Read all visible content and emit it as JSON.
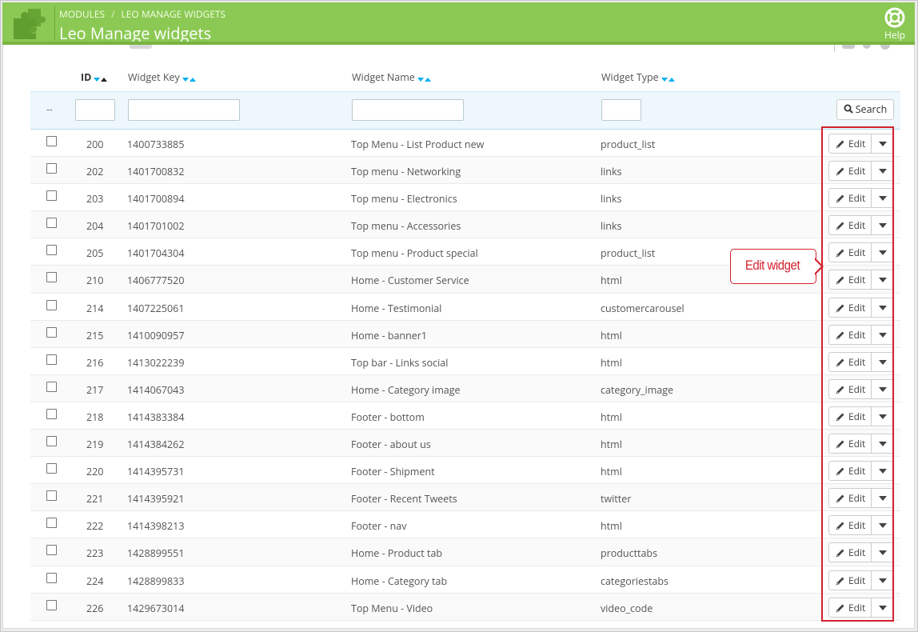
{
  "breadcrumb": {
    "module": "MODULES",
    "current": "LEO MANAGE WIDGETS"
  },
  "page_title": "Leo Manage widgets",
  "help_label": "Help",
  "colors": {
    "header_green": "#8bc954",
    "accent_blue": "#00aff0",
    "annotation_red": "#d3212d"
  },
  "columns": {
    "id": "ID",
    "key": "Widget Key",
    "name": "Widget Name",
    "type": "Widget Type"
  },
  "filter": {
    "dash": "--",
    "search_label": "Search"
  },
  "row_action": {
    "edit_label": "Edit"
  },
  "annotation": {
    "label": "Edit widget"
  },
  "rows": [
    {
      "id": "200",
      "key": "1400733885",
      "name": "Top Menu - List Product new",
      "type": "product_list"
    },
    {
      "id": "202",
      "key": "1401700832",
      "name": "Top menu - Networking",
      "type": "links"
    },
    {
      "id": "203",
      "key": "1401700894",
      "name": "Top menu - Electronics",
      "type": "links"
    },
    {
      "id": "204",
      "key": "1401701002",
      "name": "Top menu - Accessories",
      "type": "links"
    },
    {
      "id": "205",
      "key": "1401704304",
      "name": "Top menu - Product special",
      "type": "product_list"
    },
    {
      "id": "210",
      "key": "1406777520",
      "name": "Home - Customer Service",
      "type": "html"
    },
    {
      "id": "214",
      "key": "1407225061",
      "name": "Home - Testimonial",
      "type": "customercarousel"
    },
    {
      "id": "215",
      "key": "1410090957",
      "name": "Home - banner1",
      "type": "html"
    },
    {
      "id": "216",
      "key": "1413022239",
      "name": "Top bar - Links social",
      "type": "html"
    },
    {
      "id": "217",
      "key": "1414067043",
      "name": "Home - Category image",
      "type": "category_image"
    },
    {
      "id": "218",
      "key": "1414383384",
      "name": "Footer - bottom",
      "type": "html"
    },
    {
      "id": "219",
      "key": "1414384262",
      "name": "Footer - about us",
      "type": "html"
    },
    {
      "id": "220",
      "key": "1414395731",
      "name": "Footer - Shipment",
      "type": "html"
    },
    {
      "id": "221",
      "key": "1414395921",
      "name": "Footer - Recent Tweets",
      "type": "twitter"
    },
    {
      "id": "222",
      "key": "1414398213",
      "name": "Footer - nav",
      "type": "html"
    },
    {
      "id": "223",
      "key": "1428899551",
      "name": "Home - Product tab",
      "type": "producttabs"
    },
    {
      "id": "224",
      "key": "1428899833",
      "name": "Home - Category tab",
      "type": "categoriestabs"
    },
    {
      "id": "226",
      "key": "1429673014",
      "name": "Top Menu - Video",
      "type": "video_code"
    }
  ]
}
